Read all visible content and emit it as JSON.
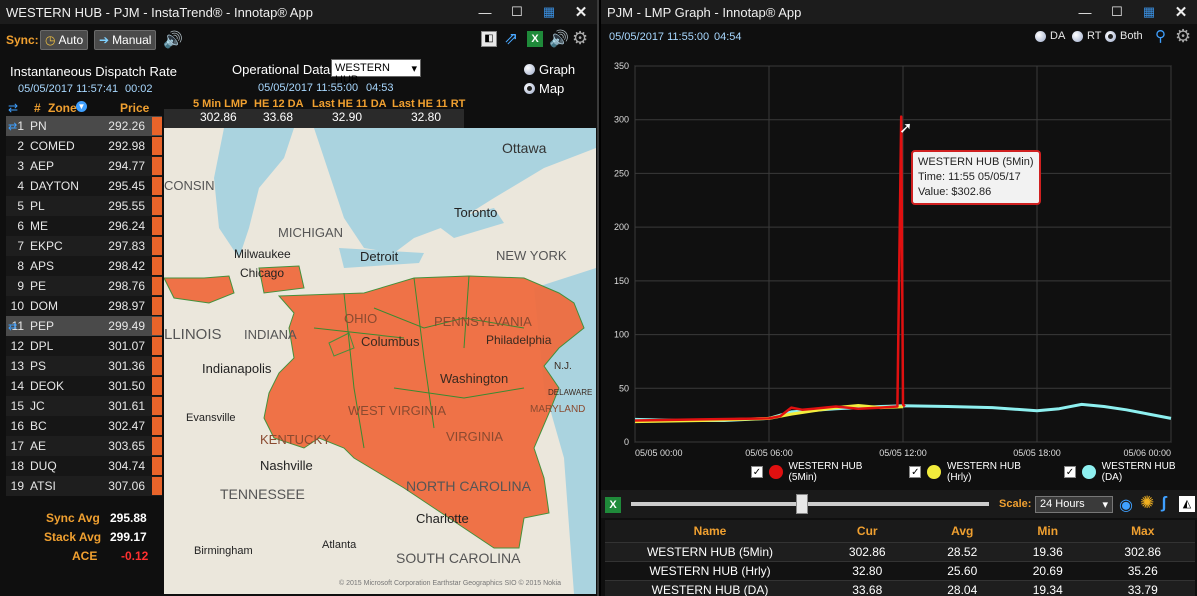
{
  "left": {
    "title": "WESTERN HUB - PJM - InstaTrend® - Innotap® App",
    "sync_label": "Sync:",
    "auto_label": "Auto",
    "manual_label": "Manual",
    "dispatch_title": "Instantaneous Dispatch Rate",
    "dispatch_time": "05/05/2017 11:57:41",
    "dispatch_elapsed": "00:02",
    "op_data_label": "Operational Data",
    "op_select": "WESTERN HUB",
    "view_graph": "Graph",
    "view_map": "Map",
    "op_time": "05/05/2017 11:55:00",
    "op_elapsed": "04:53",
    "lmp_headers": [
      "5 Min LMP",
      "HE 12 DA",
      "Last HE 11 DA",
      "Last HE 11 RT"
    ],
    "lmp_values": [
      "302.86",
      "33.68",
      "32.90",
      "32.80"
    ],
    "col_num": "#",
    "col_zone": "Zone",
    "col_price": "Price",
    "zones": [
      {
        "num": "1",
        "zone": "PN",
        "price": "292.26"
      },
      {
        "num": "2",
        "zone": "COMED",
        "price": "292.98"
      },
      {
        "num": "3",
        "zone": "AEP",
        "price": "294.77"
      },
      {
        "num": "4",
        "zone": "DAYTON",
        "price": "295.45"
      },
      {
        "num": "5",
        "zone": "PL",
        "price": "295.55"
      },
      {
        "num": "6",
        "zone": "ME",
        "price": "296.24"
      },
      {
        "num": "7",
        "zone": "EKPC",
        "price": "297.83"
      },
      {
        "num": "8",
        "zone": "APS",
        "price": "298.42"
      },
      {
        "num": "9",
        "zone": "PE",
        "price": "298.76"
      },
      {
        "num": "10",
        "zone": "DOM",
        "price": "298.97"
      },
      {
        "num": "11",
        "zone": "PEP",
        "price": "299.49"
      },
      {
        "num": "12",
        "zone": "DPL",
        "price": "301.07"
      },
      {
        "num": "13",
        "zone": "PS",
        "price": "301.36"
      },
      {
        "num": "14",
        "zone": "DEOK",
        "price": "301.50"
      },
      {
        "num": "15",
        "zone": "JC",
        "price": "301.61"
      },
      {
        "num": "16",
        "zone": "BC",
        "price": "302.47"
      },
      {
        "num": "17",
        "zone": "AE",
        "price": "303.65"
      },
      {
        "num": "18",
        "zone": "DUQ",
        "price": "304.74"
      },
      {
        "num": "19",
        "zone": "ATSI",
        "price": "307.06"
      }
    ],
    "sync_avg_label": "Sync Avg",
    "sync_avg": "295.88",
    "stack_avg_label": "Stack Avg",
    "stack_avg": "299.17",
    "ace_label": "ACE",
    "ace": "-0.12",
    "map_labels": {
      "ottawa": "Ottawa",
      "consin": "CONSIN",
      "michigan": "MICHIGAN",
      "toronto": "Toronto",
      "milwaukee": "Milwaukee",
      "chicago": "Chicago",
      "detroit": "Detroit",
      "new_york": "NEW YORK",
      "ohio": "OHIO",
      "pennsylvania": "PENNSYLVANIA",
      "illinois": "LLINOIS",
      "indiana": "INDIANA",
      "columbus": "Columbus",
      "philadelphia": "Philadelphia",
      "nj": "N.J.",
      "indianapolis": "Indianapolis",
      "washington": "Washington",
      "delaware": "DELAWARE",
      "evansville": "Evansville",
      "west_virginia": "WEST VIRGINIA",
      "maryland": "MARYLAND",
      "kentucky": "KENTUCKY",
      "virginia": "VIRGINIA",
      "nashville": "Nashville",
      "tennessee": "TENNESSEE",
      "north_carolina": "NORTH CAROLINA",
      "charlotte": "Charlotte",
      "birmingham": "Birmingham",
      "atlanta": "Atlanta",
      "south_carolina": "SOUTH CAROLINA",
      "copyright": "© 2015 Microsoft Corporation  Earthstar Geographics SIO © 2015 Nokia"
    }
  },
  "right": {
    "title": "PJM - LMP Graph - Innotap® App",
    "time": "05/05/2017 11:55:00",
    "elapsed": "04:54",
    "opt_da": "DA",
    "opt_rt": "RT",
    "opt_both": "Both",
    "scale_label": "Scale:",
    "scale_value": "24 Hours",
    "tooltip_line1": "WESTERN HUB (5Min)",
    "tooltip_line2": "Time: 11:55 05/05/17",
    "tooltip_line3": "Value: $302.86",
    "table_headers": [
      "Name",
      "Cur",
      "Avg",
      "Min",
      "Max"
    ],
    "table_rows": [
      [
        "WESTERN HUB (5Min)",
        "302.86",
        "28.52",
        "19.36",
        "302.86"
      ],
      [
        "WESTERN HUB (Hrly)",
        "32.80",
        "25.60",
        "20.69",
        "35.26"
      ],
      [
        "WESTERN HUB (DA)",
        "33.68",
        "28.04",
        "19.34",
        "33.79"
      ]
    ]
  },
  "chart_data": {
    "type": "line",
    "ylim": [
      0,
      350
    ],
    "y_ticks": [
      "0",
      "50",
      "100",
      "150",
      "200",
      "250",
      "300",
      "350"
    ],
    "x_ticks": [
      "05/05 00:00",
      "05/05 06:00",
      "05/05 12:00",
      "05/05 18:00",
      "05/06 00:00"
    ],
    "x_hours": [
      0,
      6,
      12,
      18,
      24
    ],
    "series": [
      {
        "name": "WESTERN HUB (5Min)",
        "color": "#e01010",
        "x": [
          0,
          3,
          6,
          6.5,
          7,
          7.5,
          8,
          9,
          10,
          11,
          11.75,
          11.92,
          12,
          12.08
        ],
        "y": [
          20,
          21,
          22,
          24,
          32,
          30,
          31,
          33,
          31,
          32,
          33,
          302.86,
          35,
          33
        ]
      },
      {
        "name": "WESTERN HUB (Hrly)",
        "color": "#f2ec3c",
        "x": [
          0,
          3,
          6,
          7,
          8,
          9,
          10,
          11,
          12
        ],
        "y": [
          19,
          20,
          22,
          26,
          29,
          32,
          34,
          32,
          32.8
        ]
      },
      {
        "name": "WESTERN HUB (DA)",
        "color": "#8ef0f0",
        "x": [
          0,
          2,
          4,
          6,
          7,
          9,
          11,
          12,
          14,
          16,
          18,
          19,
          20,
          21,
          22,
          23,
          24
        ],
        "y": [
          21,
          20,
          20,
          22,
          28,
          31,
          33,
          33.68,
          33,
          32,
          29,
          31,
          35,
          33,
          30,
          26,
          22
        ]
      }
    ]
  }
}
